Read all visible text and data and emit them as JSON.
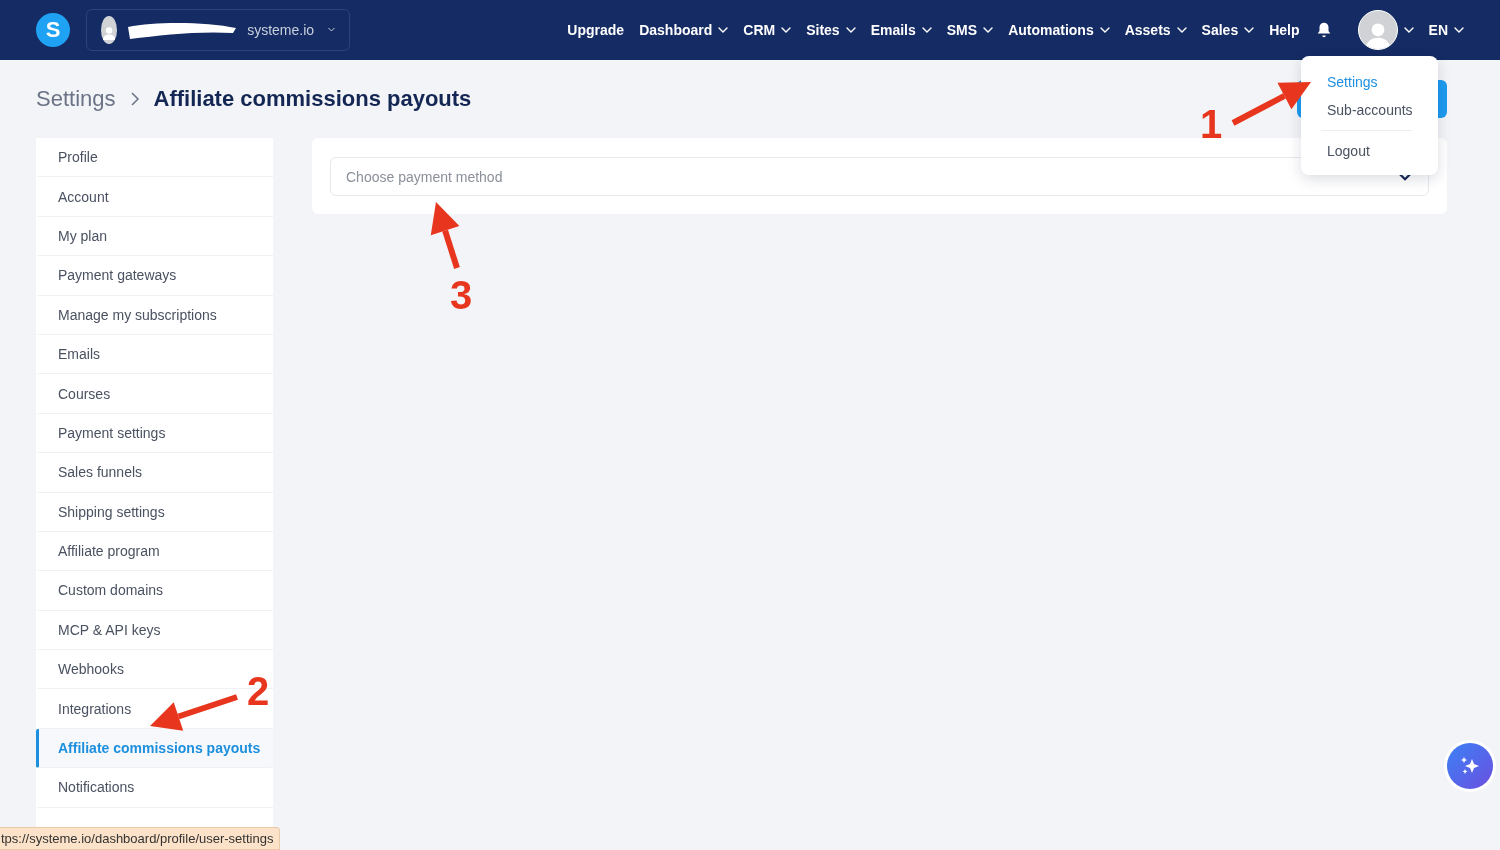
{
  "logo": {
    "letter": "S"
  },
  "account": {
    "name": "systeme.io",
    "redacted": true
  },
  "nav": [
    {
      "label": "Upgrade",
      "has_menu": false
    },
    {
      "label": "Dashboard",
      "has_menu": true
    },
    {
      "label": "CRM",
      "has_menu": true
    },
    {
      "label": "Sites",
      "has_menu": true
    },
    {
      "label": "Emails",
      "has_menu": true
    },
    {
      "label": "SMS",
      "has_menu": true
    },
    {
      "label": "Automations",
      "has_menu": true
    },
    {
      "label": "Assets",
      "has_menu": true
    },
    {
      "label": "Sales",
      "has_menu": true
    },
    {
      "label": "Help",
      "has_menu": false
    }
  ],
  "language": "EN",
  "user_menu": {
    "expanded": true,
    "groups": [
      [
        {
          "label": "Settings",
          "selected": true
        },
        {
          "label": "Sub-accounts",
          "selected": false
        }
      ],
      [
        {
          "label": "Logout",
          "selected": false
        }
      ]
    ]
  },
  "breadcrumb": [
    {
      "label": "Settings",
      "current": false
    },
    {
      "label": "Affiliate commissions payouts",
      "current": true
    }
  ],
  "sidebar": {
    "items": [
      {
        "label": "Profile",
        "selected": false
      },
      {
        "label": "Account",
        "selected": false
      },
      {
        "label": "My plan",
        "selected": false
      },
      {
        "label": "Payment gateways",
        "selected": false
      },
      {
        "label": "Manage my subscriptions",
        "selected": false
      },
      {
        "label": "Emails",
        "selected": false
      },
      {
        "label": "Courses",
        "selected": false
      },
      {
        "label": "Payment settings",
        "selected": false
      },
      {
        "label": "Sales funnels",
        "selected": false
      },
      {
        "label": "Shipping settings",
        "selected": false
      },
      {
        "label": "Affiliate program",
        "selected": false
      },
      {
        "label": "Custom domains",
        "selected": false
      },
      {
        "label": "MCP & API keys",
        "selected": false
      },
      {
        "label": "Webhooks",
        "selected": false
      },
      {
        "label": "Integrations",
        "selected": false
      },
      {
        "label": "Affiliate commissions payouts",
        "selected": true
      },
      {
        "label": "Notifications",
        "selected": false
      }
    ]
  },
  "payment_method": {
    "placeholder": "Choose payment method"
  },
  "annotations": [
    {
      "label": "1"
    },
    {
      "label": "2"
    },
    {
      "label": "3"
    }
  ],
  "status_url": "tps://systeme.io/dashboard/profile/user-settings"
}
